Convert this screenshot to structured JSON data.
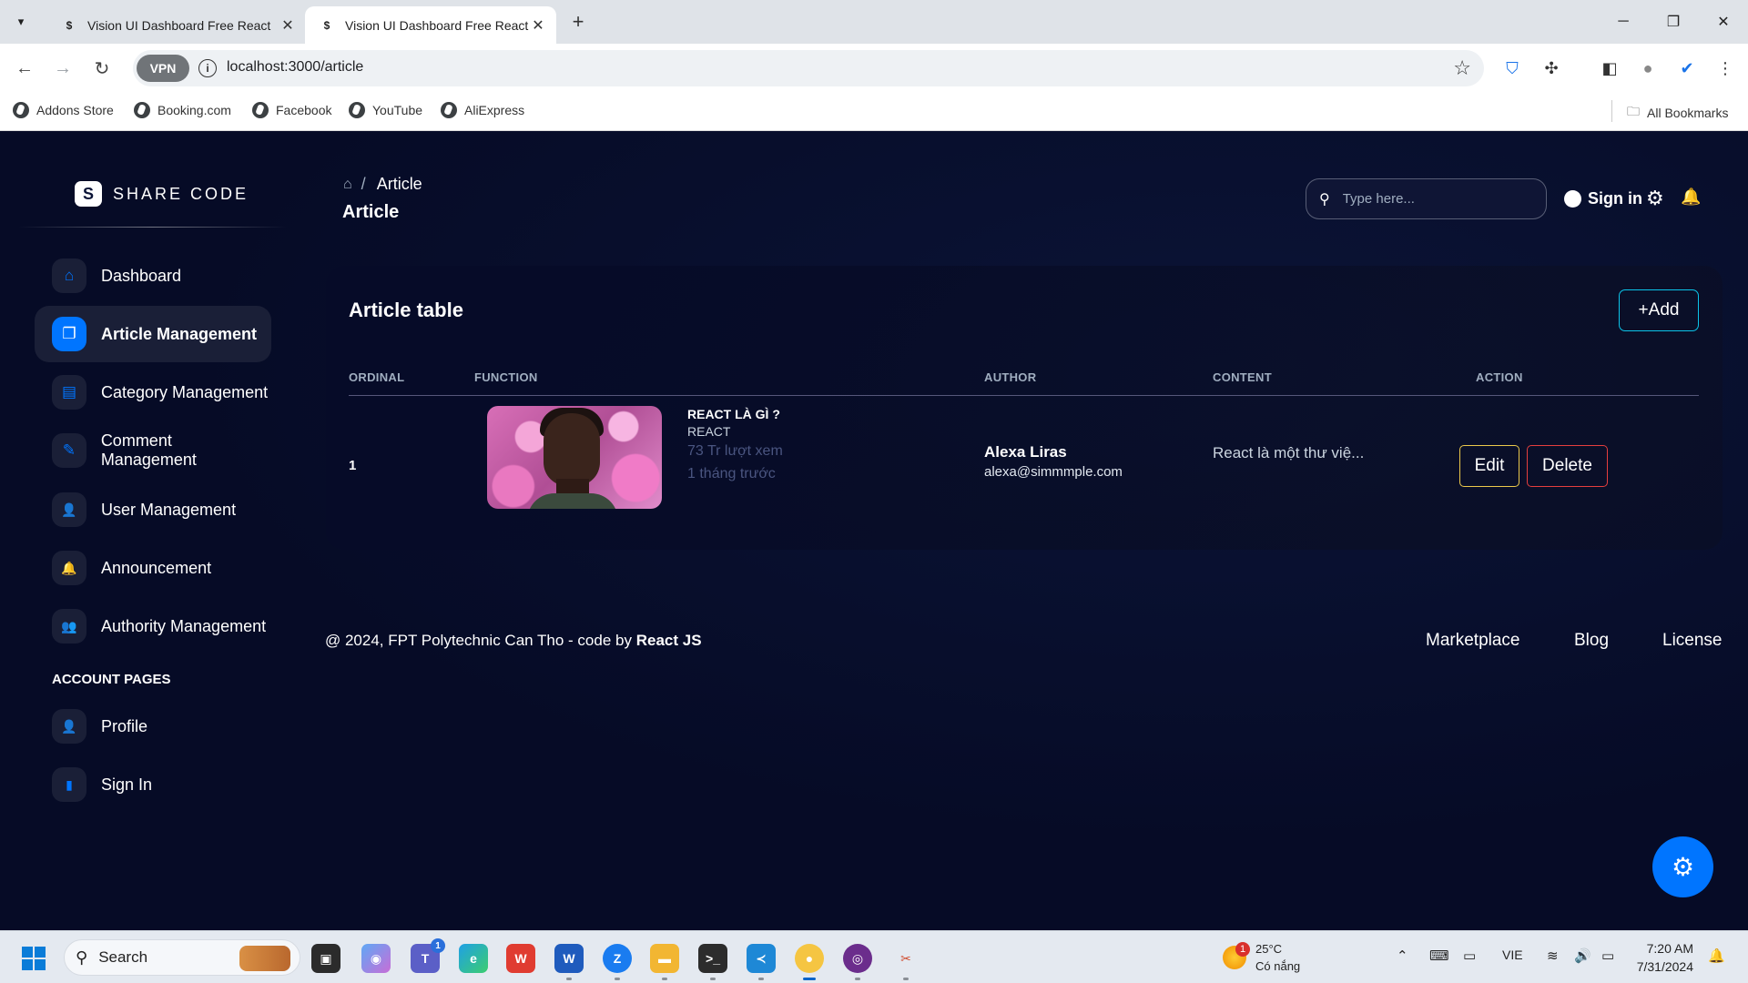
{
  "browser": {
    "tabs": [
      {
        "title": "Vision UI Dashboard Free React",
        "favicon": "$"
      },
      {
        "title": "Vision UI Dashboard Free React",
        "favicon": "$"
      }
    ],
    "vpn_label": "VPN",
    "url": "localhost:3000/article",
    "bookmarks": [
      "Addons Store",
      "Booking.com",
      "Facebook",
      "YouTube",
      "AliExpress"
    ],
    "all_bookmarks": "All Bookmarks"
  },
  "sidebar": {
    "brand_logo": "S",
    "brand": "SHARE CODE",
    "items": [
      {
        "label": "Dashboard",
        "icon": "home-icon",
        "glyph": "⌂"
      },
      {
        "label": "Article Management",
        "icon": "copy-icon",
        "glyph": "❐"
      },
      {
        "label": "Category Management",
        "icon": "document-icon",
        "glyph": "▤"
      },
      {
        "label": "Comment Management",
        "icon": "pencil-icon",
        "glyph": "✎"
      },
      {
        "label": "User Management",
        "icon": "user-add-icon",
        "glyph": "👤"
      },
      {
        "label": "Announcement",
        "icon": "bell-icon",
        "glyph": "🔔"
      },
      {
        "label": "Authority Management",
        "icon": "user-shield-icon",
        "glyph": "👥"
      }
    ],
    "section_title": "ACCOUNT PAGES",
    "account_items": [
      {
        "label": "Profile",
        "icon": "person-icon",
        "glyph": "👤"
      },
      {
        "label": "Sign In",
        "icon": "file-icon",
        "glyph": "▮"
      }
    ]
  },
  "header": {
    "breadcrumb_current": "Article",
    "page_title": "Article",
    "search_placeholder": "Type here...",
    "signin_label": "Sign in"
  },
  "table": {
    "title": "Article table",
    "add_label": "+Add",
    "columns": [
      "ORDINAL",
      "FUNCTION",
      "AUTHOR",
      "CONTENT",
      "ACTION"
    ],
    "rows": [
      {
        "ordinal": "1",
        "title": "REACT LÀ GÌ ?",
        "category": "REACT",
        "views": "73 Tr lượt xem",
        "time": "1 tháng trước",
        "author_name": "Alexa Liras",
        "author_email": "alexa@simmmple.com",
        "content": "React là một thư việ...",
        "edit_label": "Edit",
        "delete_label": "Delete"
      }
    ]
  },
  "footer": {
    "copyright": "@ 2024, FPT Polytechnic Can Tho - code by",
    "copyright_strong": "React JS",
    "links": [
      "Marketplace",
      "Blog",
      "License"
    ]
  },
  "taskbar": {
    "search_label": "Search",
    "weather_temp": "25°C",
    "weather_desc": "Có nắng",
    "weather_badge": "1",
    "teams_badge": "1",
    "language": "VIE",
    "time": "7:20 AM",
    "date": "7/31/2024"
  },
  "colors": {
    "accent": "#0075ff",
    "background": "#060b26",
    "edit_border": "#ecc94b",
    "delete_border": "#e53e3e",
    "add_border": "#0bc5ea"
  }
}
